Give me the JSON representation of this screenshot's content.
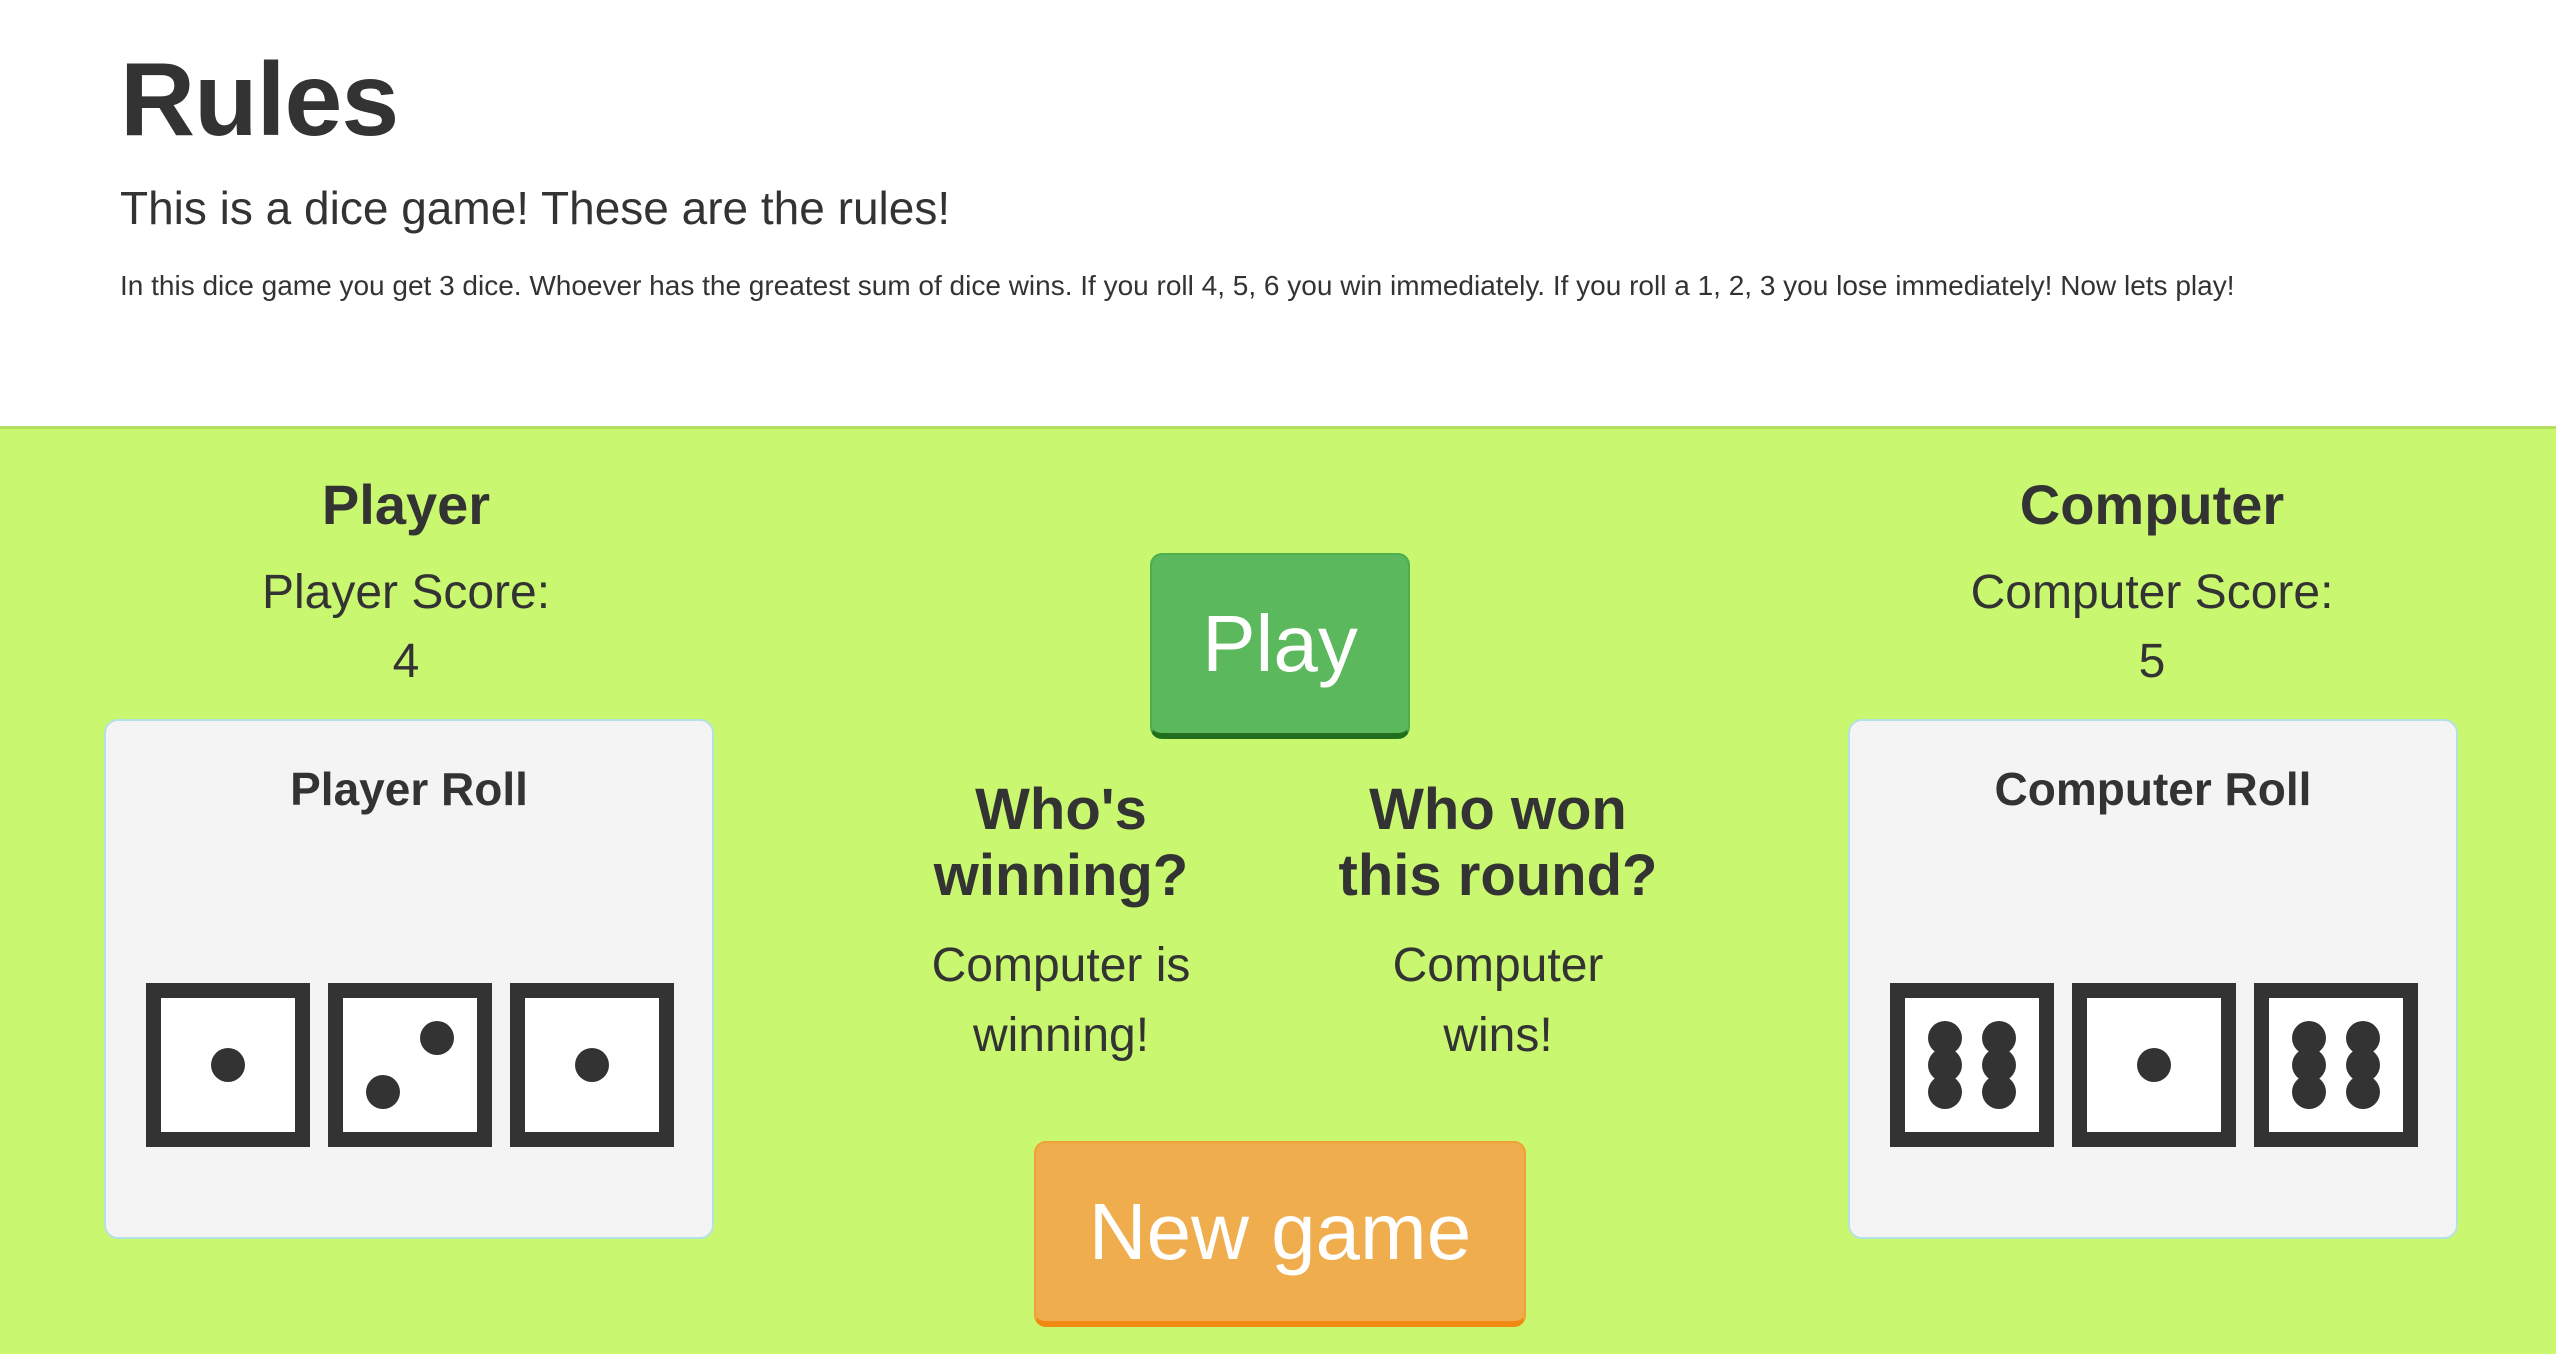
{
  "rules": {
    "title": "Rules",
    "subtitle": "This is a dice game! These are the rules!",
    "body": "In this dice game you get 3 dice. Whoever has the greatest sum of dice wins. If you roll 4, 5, 6 you win immediately. If you roll a 1, 2, 3 you lose immediately! Now lets play!"
  },
  "player": {
    "title": "Player",
    "score_label": "Player Score:",
    "score": "4",
    "roll_title": "Player Roll",
    "dice": [
      1,
      2,
      1
    ]
  },
  "computer": {
    "title": "Computer",
    "score_label": "Computer Score:",
    "score": "5",
    "roll_title": "Computer Roll",
    "dice": [
      6,
      1,
      6
    ]
  },
  "controls": {
    "play_label": "Play",
    "new_game_label": "New game"
  },
  "status": {
    "winning_heading": "Who's winning?",
    "winning_text": "Computer is winning!",
    "round_heading": "Who won this round?",
    "round_text": "Computer wins!"
  },
  "colors": {
    "game_background": "#c9f76f",
    "play_button": "#5cb85c",
    "new_game_button": "#f0ad4e",
    "roll_box": "#f4f4f4",
    "die_ink": "#333333"
  }
}
